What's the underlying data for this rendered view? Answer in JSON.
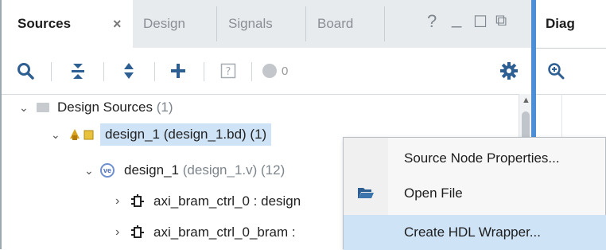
{
  "tabs": [
    {
      "label": "Sources",
      "active": true
    },
    {
      "label": "Design"
    },
    {
      "label": "Signals"
    },
    {
      "label": "Board"
    }
  ],
  "tab_close": "×",
  "window_controls": {
    "help": "?",
    "minimize": "_",
    "restore": "☐",
    "float": "⧉"
  },
  "toolbar": {
    "icons": [
      "search-icon",
      "collapse-all-icon",
      "expand-all-icon",
      "add-icon",
      "help-box-icon",
      "status-dot-icon",
      "gear-icon"
    ],
    "status_count": "0"
  },
  "tree": {
    "root": {
      "label": "Design Sources",
      "count": "(1)"
    },
    "bd": {
      "label": "design_1 (design_1.bd) (1)"
    },
    "v": {
      "name": "design_1",
      "file": "(design_1.v) (12)"
    },
    "child1": {
      "label": "axi_bram_ctrl_0 : design"
    },
    "child2": {
      "label": "axi_bram_ctrl_0_bram :"
    }
  },
  "right_panel": {
    "tab_label": "Diag"
  },
  "context_menu": {
    "items": [
      {
        "label": "Source Node Properties..."
      },
      {
        "label": "Open File",
        "icon": "open-folder-icon"
      },
      {
        "label": "Create HDL Wrapper...",
        "highlighted": true
      }
    ]
  },
  "colors": {
    "accent": "#4d8fd6",
    "selection": "#cfe3f7",
    "tabbar": "#e8ebee"
  }
}
